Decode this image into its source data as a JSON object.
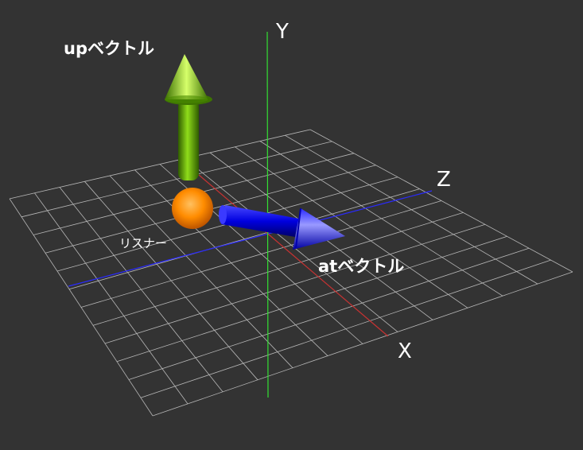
{
  "scene": {
    "background": "#333333",
    "grid_color": "#cfcfcf",
    "axes": {
      "x": {
        "label": "X",
        "color": "#c83232"
      },
      "y": {
        "label": "Y",
        "color": "#33e033"
      },
      "z": {
        "label": "Z",
        "color": "#2a2aff"
      }
    },
    "listener": {
      "label": "リスナー",
      "color": "#ff8c00"
    },
    "up_vector": {
      "label": "upベクトル",
      "color": "#5fb000"
    },
    "at_vector": {
      "label": "atベクトル",
      "color": "#1a1aff"
    }
  }
}
